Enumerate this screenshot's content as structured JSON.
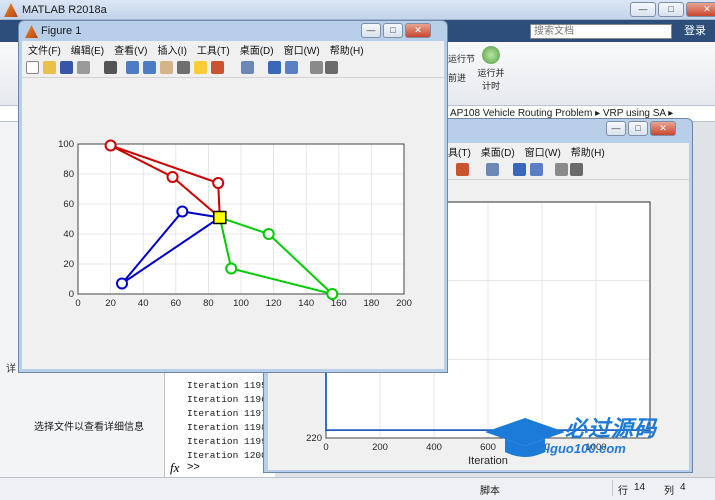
{
  "main_window": {
    "title": "MATLAB R2018a",
    "search_placeholder": "搜索文档",
    "login_label": "登录",
    "ribbon": {
      "run_section_label": "运行节",
      "advance_label": "前进",
      "run_time_label": "运行并\n计时"
    },
    "address_path": "AP108 Vehicle Routing Problem  ▸  VRP using SA  ▸",
    "left_panel": {
      "details_header": "详",
      "details_message": "选择文件以查看详细信息"
    },
    "command_window": {
      "lines": [
        "Iteration 1195:",
        "Iteration 1196:",
        "Iteration 1197:",
        "Iteration 1198:",
        "Iteration 1199:",
        "Iteration 1200:"
      ],
      "fx_label": "fx",
      "prompt": ">>"
    },
    "status_bar": {
      "script_label": "脚本",
      "line_label": "行",
      "line_value": "14",
      "col_label": "列",
      "col_value": "4"
    }
  },
  "figure1": {
    "title": "Figure 1",
    "menu": [
      "文件(F)",
      "编辑(E)",
      "查看(V)",
      "插入(I)",
      "工具(T)",
      "桌面(D)",
      "窗口(W)",
      "帮助(H)"
    ],
    "chart_data": {
      "type": "line",
      "title": "",
      "xlabel": "",
      "ylabel": "",
      "xlim": [
        0,
        200
      ],
      "ylim": [
        0,
        100
      ],
      "xticks": [
        0,
        20,
        40,
        60,
        80,
        100,
        120,
        140,
        160,
        180,
        200
      ],
      "yticks": [
        0,
        20,
        40,
        60,
        80,
        100
      ],
      "grid": true,
      "depot": {
        "x": 87,
        "y": 51,
        "color": "#ffff00"
      },
      "series": [
        {
          "color": "#cc0000",
          "points": [
            [
              87,
              51
            ],
            [
              86,
              74
            ],
            [
              20,
              99
            ],
            [
              58,
              78
            ],
            [
              87,
              51
            ]
          ]
        },
        {
          "color": "#0000cc",
          "points": [
            [
              87,
              51
            ],
            [
              64,
              55
            ],
            [
              27,
              7
            ],
            [
              87,
              51
            ]
          ]
        },
        {
          "color": "#00cc00",
          "points": [
            [
              87,
              51
            ],
            [
              117,
              40
            ],
            [
              156,
              0
            ],
            [
              94,
              17
            ],
            [
              87,
              51
            ]
          ]
        }
      ]
    }
  },
  "figure2": {
    "menu": [
      "具(T)",
      "桌面(D)",
      "窗口(W)",
      "帮助(H)"
    ],
    "chart_data": {
      "type": "line",
      "title": "",
      "xlabel": "Iteration",
      "ylabel": "",
      "xlim": [
        0,
        1200
      ],
      "ylim": [
        220,
        250
      ],
      "xticks": [
        0,
        200,
        400,
        600,
        800,
        1000
      ],
      "yticks": [
        220,
        230,
        240
      ],
      "grid": true,
      "series": [
        {
          "color": "#1f5fbf",
          "x": [
            0,
            0,
            10,
            1200
          ],
          "y": [
            250,
            221,
            221,
            221
          ]
        }
      ]
    }
  },
  "watermark": {
    "title": "必过源码",
    "url": "Biguo100.com"
  }
}
